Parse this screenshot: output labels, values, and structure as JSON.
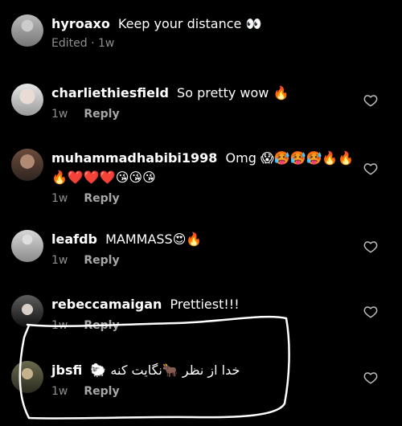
{
  "caption": {
    "username": "hyroaxo",
    "text": "Keep your distance 👀",
    "edited": "Edited",
    "time": "1w",
    "separator": "·"
  },
  "comments": [
    {
      "username": "charliethiesfield",
      "text": "So pretty wow 🔥",
      "time": "1w",
      "reply": "Reply"
    },
    {
      "username": "muhammadhabibi1998",
      "text": "Omg 😱🥵🥵🥵🔥🔥🔥❤️❤️❤️😘😘😘",
      "time": "1w",
      "reply": "Reply"
    },
    {
      "username": "leafdb",
      "text": "MAMMASS😍🔥",
      "time": "1w",
      "reply": "Reply"
    },
    {
      "username": "rebeccamaigan",
      "text": "Prettiest!!!",
      "time": "1w",
      "reply": "Reply"
    },
    {
      "username": "jbsfi",
      "text": "خدا از نظر 🐂نگایت کنه 🐑",
      "time": "1w",
      "reply": "Reply"
    }
  ]
}
